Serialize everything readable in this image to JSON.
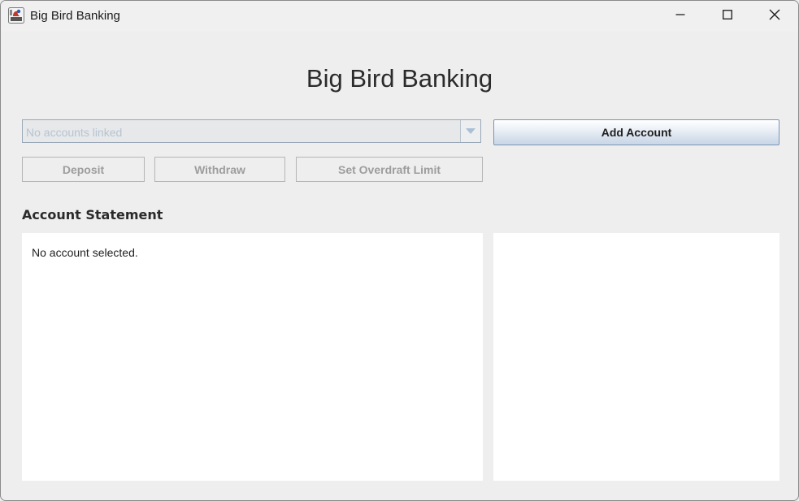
{
  "window": {
    "title": "Big Bird Banking",
    "app_icon": "java-app-icon",
    "controls": {
      "minimize_icon": "minimize-icon",
      "maximize_icon": "maximize-icon",
      "close_icon": "close-icon"
    }
  },
  "main": {
    "heading": "Big Bird Banking",
    "account_selector": {
      "selected": "No accounts linked",
      "enabled": false,
      "icon": "chevron-down-icon"
    },
    "add_account_label": "Add Account",
    "actions": {
      "deposit_label": "Deposit",
      "withdraw_label": "Withdraw",
      "overdraft_label": "Set Overdraft Limit",
      "enabled": false
    },
    "statement": {
      "label": "Account Statement",
      "text": "No account selected."
    }
  },
  "colors": {
    "window_bg": "#eeeeee",
    "panel_bg": "#ffffff",
    "disabled_text": "#9d9d9d",
    "placeholder_text": "#b6c4d2",
    "primary_button_border": "#7c94b4"
  }
}
